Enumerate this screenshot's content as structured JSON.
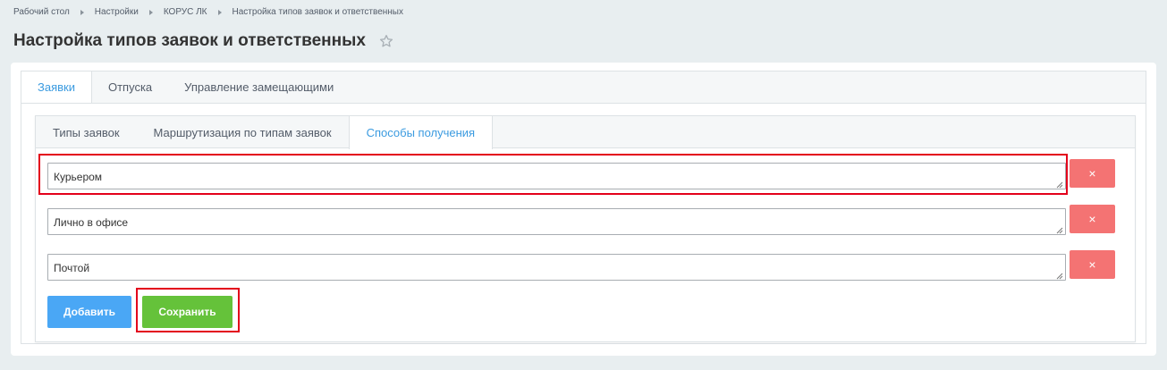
{
  "breadcrumb": [
    "Рабочий стол",
    "Настройки",
    "КОРУС ЛК",
    "Настройка типов заявок и ответственных"
  ],
  "page_title": "Настройка типов заявок и ответственных",
  "outer_tabs": [
    {
      "label": "Заявки",
      "active": true
    },
    {
      "label": "Отпуска",
      "active": false
    },
    {
      "label": "Управление замещающими",
      "active": false
    }
  ],
  "inner_tabs": [
    {
      "label": "Типы заявок",
      "active": false
    },
    {
      "label": "Маршрутизация по типам заявок",
      "active": false
    },
    {
      "label": "Способы получения",
      "active": true
    }
  ],
  "methods": [
    {
      "value": "Курьером"
    },
    {
      "value": "Лично в офисе"
    },
    {
      "value": "Почтой"
    }
  ],
  "remove_label": "×",
  "buttons": {
    "add_label": "Добавить",
    "save_label": "Сохранить"
  },
  "colors": {
    "accent": "#3b9be0",
    "add_button": "#4aa7f5",
    "save_button": "#65c23a",
    "remove_button": "#f47373",
    "highlight": "#e3001b"
  }
}
